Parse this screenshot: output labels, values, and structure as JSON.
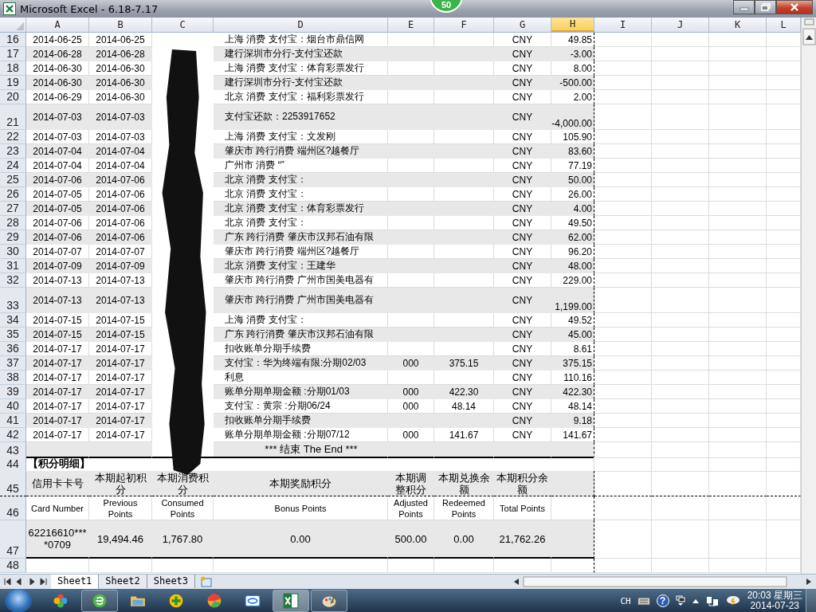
{
  "window": {
    "title": "Microsoft Excel - 6.18-7.17",
    "badge": "50"
  },
  "columns": [
    {
      "label": "A",
      "selected": false
    },
    {
      "label": "B",
      "selected": false
    },
    {
      "label": "C",
      "selected": false
    },
    {
      "label": "D",
      "selected": false
    },
    {
      "label": "E",
      "selected": false
    },
    {
      "label": "F",
      "selected": false
    },
    {
      "label": "G",
      "selected": false
    },
    {
      "label": "H",
      "selected": true
    },
    {
      "label": "I",
      "selected": false
    },
    {
      "label": "J",
      "selected": false
    },
    {
      "label": "K",
      "selected": false
    },
    {
      "label": "L",
      "selected": false
    }
  ],
  "rows": [
    {
      "number": "16",
      "kind": "entry",
      "cells": {
        "a": "2014-06-25",
        "b": "2014-06-25",
        "d": "上海 消费 支付宝：烟台市鼎信网",
        "g": "CNY",
        "h": "49.85"
      }
    },
    {
      "number": "17",
      "kind": "entry",
      "cells": {
        "a": "2014-06-28",
        "b": "2014-06-28",
        "d": "建行深圳市分行-支付宝还款",
        "g": "CNY",
        "h": "-3.00"
      }
    },
    {
      "number": "18",
      "kind": "entry",
      "cells": {
        "a": "2014-06-30",
        "b": "2014-06-30",
        "d": "上海 消费 支付宝：体育彩票发行",
        "g": "CNY",
        "h": "8.00"
      }
    },
    {
      "number": "19",
      "kind": "entry",
      "cells": {
        "a": "2014-06-30",
        "b": "2014-06-30",
        "d": "建行深圳市分行-支付宝还款",
        "g": "CNY",
        "h": "-500.00"
      }
    },
    {
      "number": "20",
      "kind": "entry",
      "cells": {
        "a": "2014-06-29",
        "b": "2014-06-30",
        "d": "北京 消费 支付宝：福利彩票发行",
        "g": "CNY",
        "h": "2.00"
      }
    },
    {
      "number": "21",
      "kind": "entry",
      "cells": {
        "a": "2014-07-03",
        "b": "2014-07-03",
        "d": "支付宝还款：2253917652",
        "g": "CNY",
        "h": "-4,000.00"
      }
    },
    {
      "number": "22",
      "kind": "entry",
      "cells": {
        "a": "2014-07-03",
        "b": "2014-07-03",
        "d": "上海 消费 支付宝：文发刚",
        "g": "CNY",
        "h": "105.90"
      }
    },
    {
      "number": "23",
      "kind": "entry",
      "cells": {
        "a": "2014-07-04",
        "b": "2014-07-04",
        "d": "肇庆市 跨行消费 端州区?越餐厅",
        "g": "CNY",
        "h": "83.60"
      }
    },
    {
      "number": "24",
      "kind": "entry",
      "cells": {
        "a": "2014-07-04",
        "b": "2014-07-04",
        "d": "广州市 消费 “”",
        "g": "CNY",
        "h": "77.19"
      }
    },
    {
      "number": "25",
      "kind": "entry",
      "cells": {
        "a": "2014-07-06",
        "b": "2014-07-06",
        "d": "北京 消费 支付宝：",
        "g": "CNY",
        "h": "50.00"
      }
    },
    {
      "number": "26",
      "kind": "entry",
      "cells": {
        "a": "2014-07-05",
        "b": "2014-07-06",
        "d": "北京 消费 支付宝：",
        "g": "CNY",
        "h": "26.00"
      }
    },
    {
      "number": "27",
      "kind": "entry",
      "cells": {
        "a": "2014-07-05",
        "b": "2014-07-06",
        "d": "北京 消费 支付宝：体育彩票发行",
        "g": "CNY",
        "h": "4.00"
      }
    },
    {
      "number": "28",
      "kind": "entry",
      "cells": {
        "a": "2014-07-06",
        "b": "2014-07-06",
        "d": "北京 消费 支付宝：",
        "g": "CNY",
        "h": "49.50"
      }
    },
    {
      "number": "29",
      "kind": "entry",
      "cells": {
        "a": "2014-07-06",
        "b": "2014-07-06",
        "d": "广东 跨行消费 肇庆市汉邦石油有限",
        "g": "CNY",
        "h": "62.00"
      }
    },
    {
      "number": "30",
      "kind": "entry",
      "cells": {
        "a": "2014-07-07",
        "b": "2014-07-07",
        "d": "肇庆市 跨行消费 端州区?越餐厅",
        "g": "CNY",
        "h": "96.20"
      }
    },
    {
      "number": "31",
      "kind": "entry",
      "cells": {
        "a": "2014-07-09",
        "b": "2014-07-09",
        "d": "北京 消费 支付宝：王建华",
        "g": "CNY",
        "h": "48.00"
      }
    },
    {
      "number": "32",
      "kind": "entry",
      "cells": {
        "a": "2014-07-13",
        "b": "2014-07-13",
        "d": "肇庆市 跨行消费 广州市国美电器有",
        "g": "CNY",
        "h": "229.00"
      }
    },
    {
      "number": "33",
      "kind": "entry",
      "cells": {
        "a": "2014-07-13",
        "b": "2014-07-13",
        "d": "肇庆市 跨行消费 广州市国美电器有",
        "g": "CNY",
        "h": "1,199.00"
      }
    },
    {
      "number": "34",
      "kind": "entry",
      "cells": {
        "a": "2014-07-15",
        "b": "2014-07-15",
        "d": "上海 消费 支付宝：",
        "g": "CNY",
        "h": "49.52"
      }
    },
    {
      "number": "35",
      "kind": "entry",
      "cells": {
        "a": "2014-07-15",
        "b": "2014-07-15",
        "d": "广东 跨行消费 肇庆市汉邦石油有限",
        "g": "CNY",
        "h": "45.00"
      }
    },
    {
      "number": "36",
      "kind": "entry",
      "cells": {
        "a": "2014-07-17",
        "b": "2014-07-17",
        "d": "扣收账单分期手续费",
        "g": "CNY",
        "h": "8.61"
      }
    },
    {
      "number": "37",
      "kind": "entry",
      "cells": {
        "a": "2014-07-17",
        "b": "2014-07-17",
        "d": "支付宝：华为终端有限:分期02/03",
        "e": "000",
        "f": "375.15",
        "g": "CNY",
        "h": "375.15"
      }
    },
    {
      "number": "38",
      "kind": "entry",
      "cells": {
        "a": "2014-07-17",
        "b": "2014-07-17",
        "d": "利息",
        "g": "CNY",
        "h": "110.16"
      }
    },
    {
      "number": "39",
      "kind": "entry",
      "cells": {
        "a": "2014-07-17",
        "b": "2014-07-17",
        "d": "账单分期单期金额 :分期01/03",
        "e": "000",
        "f": "422.30",
        "g": "CNY",
        "h": "422.30"
      }
    },
    {
      "number": "40",
      "kind": "entry",
      "cells": {
        "a": "2014-07-17",
        "b": "2014-07-17",
        "d": "支付宝：黄宗 :分期06/24",
        "e": "000",
        "f": "48.14",
        "g": "CNY",
        "h": "48.14"
      }
    },
    {
      "number": "41",
      "kind": "entry",
      "cells": {
        "a": "2014-07-17",
        "b": "2014-07-17",
        "d": "扣收账单分期手续费",
        "g": "CNY",
        "h": "9.18"
      }
    },
    {
      "number": "42",
      "kind": "entry",
      "cells": {
        "a": "2014-07-17",
        "b": "2014-07-17",
        "d": "账单分期单期金额 :分期07/12",
        "e": "000",
        "f": "141.67",
        "g": "CNY",
        "h": "141.67"
      }
    },
    {
      "number": "43",
      "kind": "end",
      "cells": {
        "d": "*** 结束 The End ***"
      }
    },
    {
      "number": "44",
      "kind": "section-title",
      "cells": {
        "a": "【积分明细】"
      }
    },
    {
      "number": "45",
      "kind": "header",
      "cells": {
        "a": "信用卡卡号",
        "b": "本期起初积分",
        "c": "本期消费积分",
        "d": "本期奖励积分",
        "e": "本期调整积分",
        "f": "本期兑换余额",
        "g": "本期积分余额"
      }
    },
    {
      "number": "46",
      "kind": "subheader",
      "cells": {
        "a": "Card Number",
        "b": "Previous Points",
        "c": "Consumed Points",
        "d": "Bonus Points",
        "e": "Adjusted Points",
        "f": "Redeemed Points",
        "g": "Total Points"
      }
    },
    {
      "number": "47",
      "kind": "values",
      "cells": {
        "a": "62216610****0709",
        "b": "19,494.46",
        "c": "1,767.80",
        "d": "0.00",
        "e": "500.00",
        "f": "0.00",
        "g": "21,762.26"
      }
    },
    {
      "number": "48",
      "kind": "blank",
      "cells": {}
    }
  ],
  "sheet_tabs": [
    {
      "label": "Sheet1",
      "selected": true
    },
    {
      "label": "Sheet2",
      "selected": false
    },
    {
      "label": "Sheet3",
      "selected": false
    }
  ],
  "taskbar": {
    "apps": [
      {
        "kind": "pinwheel",
        "running": false,
        "active": false
      },
      {
        "kind": "browser",
        "running": true,
        "active": false
      },
      {
        "kind": "folder",
        "running": false,
        "active": false
      },
      {
        "kind": "plus",
        "running": false,
        "active": false
      },
      {
        "kind": "ball",
        "running": false,
        "active": false
      },
      {
        "kind": "cloud",
        "running": false,
        "active": false
      },
      {
        "kind": "excel",
        "running": true,
        "active": true
      },
      {
        "kind": "paint",
        "running": true,
        "active": false
      }
    ],
    "language": "CH",
    "help": "?",
    "time": "20:03 星期三",
    "date": "2014-07-23"
  }
}
